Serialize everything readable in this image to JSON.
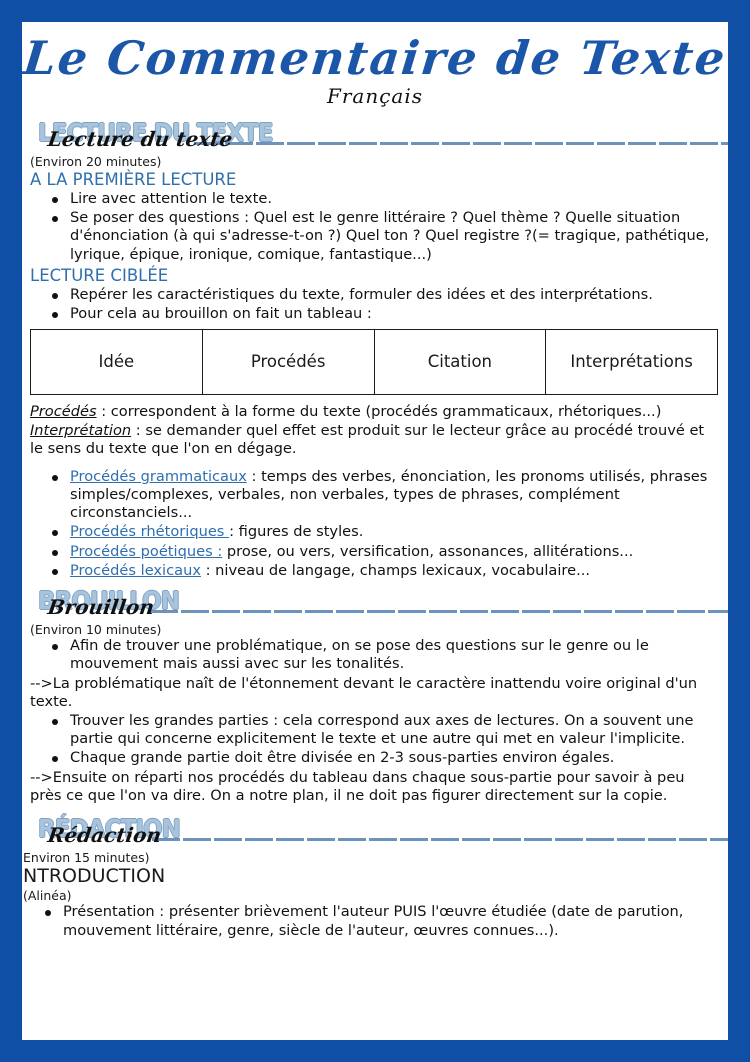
{
  "document": {
    "title": "Le Commentaire de Texte",
    "subtitle": "Français",
    "border_color": "#0f4fa5",
    "accent_blue": "#2f6fae",
    "header_block_color": "#a8c3dc"
  },
  "sections": [
    {
      "id": "lecture-du-texte",
      "block_caps": "LECTURE DU TEXTE",
      "script_overlay": "Lecture du texte",
      "duration": "(Environ 20 minutes)",
      "subsections": [
        {
          "heading": "A LA PREMIÈRE LECTURE",
          "bullets": [
            "Lire avec attention le texte.",
            "Se poser des questions : Quel est le genre littéraire ? Quel thème ? Quelle situation d'énonciation (à qui s'adresse-t-on ?) Quel ton ? Quel registre ?(= tragique, pathétique, lyrique, épique, ironique, comique, fantastique...)"
          ]
        },
        {
          "heading": "LECTURE CIBLÉE",
          "bullets": [
            "Repérer les caractéristiques du texte, formuler des idées et des interprétations.",
            "Pour cela au brouillon on fait un tableau :"
          ]
        }
      ],
      "table": {
        "columns": [
          "Idée",
          "Procédés",
          "Citation",
          "Interprétations"
        ]
      },
      "definitions": [
        {
          "term": "Procédés",
          "sep": " : ",
          "text": "correspondent à la forme du texte (procédés grammaticaux, rhétoriques...)"
        },
        {
          "term": "Interprétation",
          "sep": " : ",
          "text": "se demander quel effet est produit sur le lecteur grâce au procédé trouvé et le sens du texte que l'on en dégage."
        }
      ],
      "procedes_list": [
        {
          "label": "Procédés grammaticaux",
          "sep": " : ",
          "text": "temps des verbes, énonciation, les pronoms utilisés, phrases simples/complexes, verbales, non verbales, types de phrases, complément circonstanciels..."
        },
        {
          "label": "Procédés rhétoriques ",
          "sep": ": ",
          "text": "figures de styles."
        },
        {
          "label": "Procédés poétiques :",
          "sep": " ",
          "text": "prose, ou vers, versification, assonances, allitérations..."
        },
        {
          "label": "Procédés lexicaux",
          "sep": " : ",
          "text": "niveau de langage, champs lexicaux, vocabulaire..."
        }
      ]
    },
    {
      "id": "brouillon",
      "block_caps": "BROUILLON",
      "script_overlay": "Brouillon",
      "duration": "(Environ 10 minutes)",
      "lines": [
        {
          "type": "bullet",
          "text": "Afin de trouver une problématique, on se pose des questions sur le genre ou le mouvement mais aussi avec sur les tonalités."
        },
        {
          "type": "arrow",
          "text": "-->La problématique naît de l'étonnement devant le caractère inattendu voire original d'un texte."
        },
        {
          "type": "bullet",
          "text": "Trouver les grandes parties : cela correspond aux axes de lectures. On a souvent une partie qui concerne explicitement le texte et une autre qui met en valeur l'implicite."
        },
        {
          "type": "bullet",
          "text": "Chaque grande partie doit être divisée en 2-3 sous-parties environ égales."
        },
        {
          "type": "arrow",
          "text": "-->Ensuite on réparti nos procédés du tableau dans chaque sous-partie pour savoir à peu près ce que l'on va dire. On a notre plan, il ne doit pas figurer directement sur la copie."
        }
      ]
    },
    {
      "id": "redaction",
      "block_caps": "RÉDACTION",
      "script_overlay": "Rédaction",
      "duration": "Environ 15 minutes)",
      "heading": "NTRODUCTION",
      "note": "(Alinéa)",
      "bullets": [
        "Présentation : présenter brièvement l'auteur PUIS l'œuvre étudiée (date de parution, mouvement littéraire, genre, siècle de l'auteur, œuvres connues...)."
      ]
    }
  ]
}
